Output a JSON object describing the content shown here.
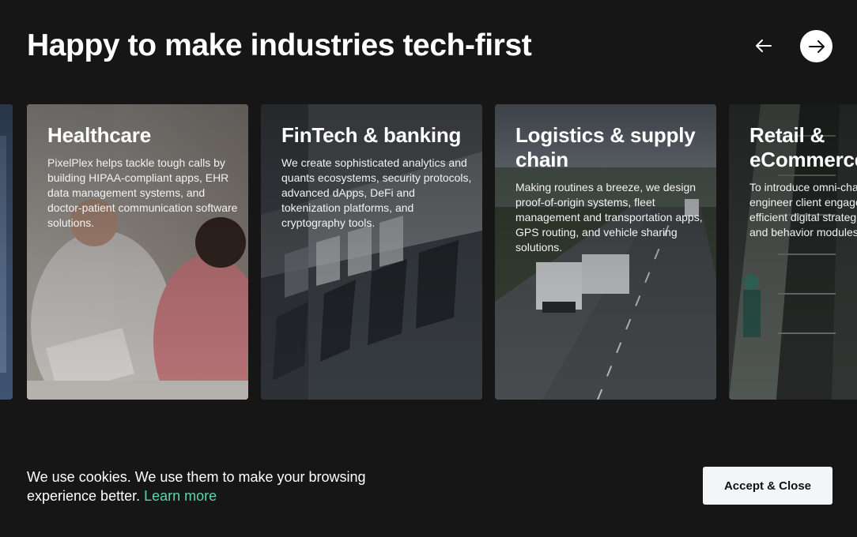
{
  "section": {
    "title": "Happy to make industries tech-first"
  },
  "carousel": {
    "prev_icon": "arrow-left-icon",
    "next_icon": "arrow-right-icon",
    "cards": [
      {
        "title": "Healthcare",
        "text": "PixelPlex helps tackle tough calls by building HIPAA-compliant apps, EHR data management systems, and doctor-patient communication software solutions."
      },
      {
        "title": "FinTech & banking",
        "text": "We create sophisticated analytics and quants ecosystems, security protocols, advanced dApps, DeFi and tokenization platforms, and cryptography tools."
      },
      {
        "title": "Logistics & supply chain",
        "text": "Making routines a breeze, we design proof-of-origin systems, fleet management and transportation apps, GPS routing, and vehicle sharing solutions."
      },
      {
        "title": "Retail & eCommerce",
        "text": "To introduce omni-channel, we engineer client engagement and efficient digital strategies, preferences and behavior modules."
      }
    ]
  },
  "cookie_banner": {
    "text": "We use cookies. We use them to make your browsing experience better.",
    "link_label": "Learn more",
    "accept_label": "Accept & Close"
  },
  "colors": {
    "background": "#161616",
    "link": "#5fd3ad",
    "button_bg": "#f4f5f7"
  }
}
